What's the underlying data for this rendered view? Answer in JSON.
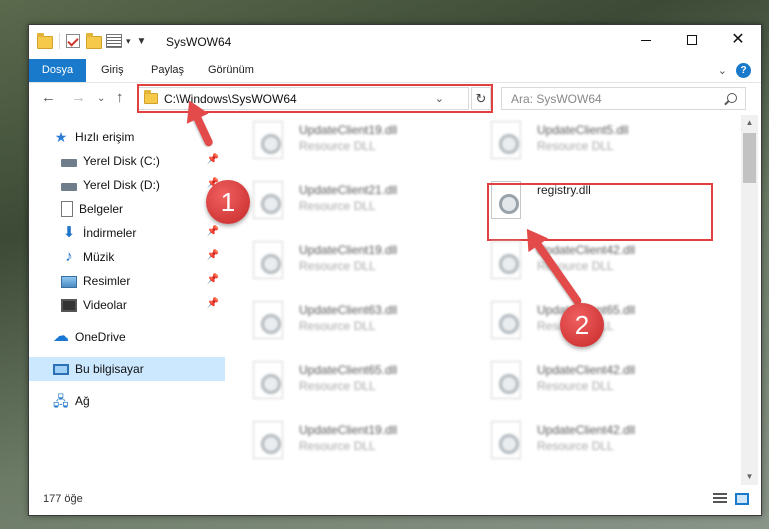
{
  "window": {
    "title": "SysWOW64"
  },
  "ribbon": {
    "tabs": [
      "Dosya",
      "Giriş",
      "Paylaş",
      "Görünüm"
    ],
    "file_tab_color": "#1979ca"
  },
  "navigation": {
    "address": "C:\\Windows\\SysWOW64",
    "search_placeholder": "Ara: SysWOW64"
  },
  "sidebar": {
    "items": [
      {
        "label": "Hızlı erişim",
        "icon": "star-icon"
      },
      {
        "label": "Yerel Disk (C:)",
        "icon": "drive-icon",
        "pinned": true
      },
      {
        "label": "Yerel Disk (D:)",
        "icon": "drive-icon",
        "pinned": true
      },
      {
        "label": "Belgeler",
        "icon": "documents-icon",
        "pinned": true
      },
      {
        "label": "İndirmeler",
        "icon": "download-icon",
        "pinned": true
      },
      {
        "label": "Müzik",
        "icon": "music-icon",
        "pinned": true
      },
      {
        "label": "Resimler",
        "icon": "pictures-icon",
        "pinned": true
      },
      {
        "label": "Videolar",
        "icon": "videos-icon",
        "pinned": true
      },
      {
        "label": "OneDrive",
        "icon": "onedrive-icon"
      },
      {
        "label": "Bu bilgisayar",
        "icon": "computer-icon",
        "selected": true
      },
      {
        "label": "Ağ",
        "icon": "network-icon"
      }
    ]
  },
  "files": {
    "type_label": "Resource DLL",
    "left_column": [
      "UpdateClient19.dll",
      "UpdateClient21.dll",
      "UpdateClient19.dll",
      "UpdateClient63.dll",
      "UpdateClient65.dll",
      "UpdateClient19.dll"
    ],
    "right_column": [
      "UpdateClient5.dll",
      "registry.dll",
      "UpdateClient42.dll",
      "UpdateClient65.dll",
      "UpdateClient42.dll",
      "UpdateClient42.dll"
    ],
    "highlighted": "registry.dll"
  },
  "status": {
    "item_count": "177 öğe"
  },
  "annotations": {
    "badge_1": "1",
    "badge_2": "2",
    "color": "#e34a4a"
  }
}
